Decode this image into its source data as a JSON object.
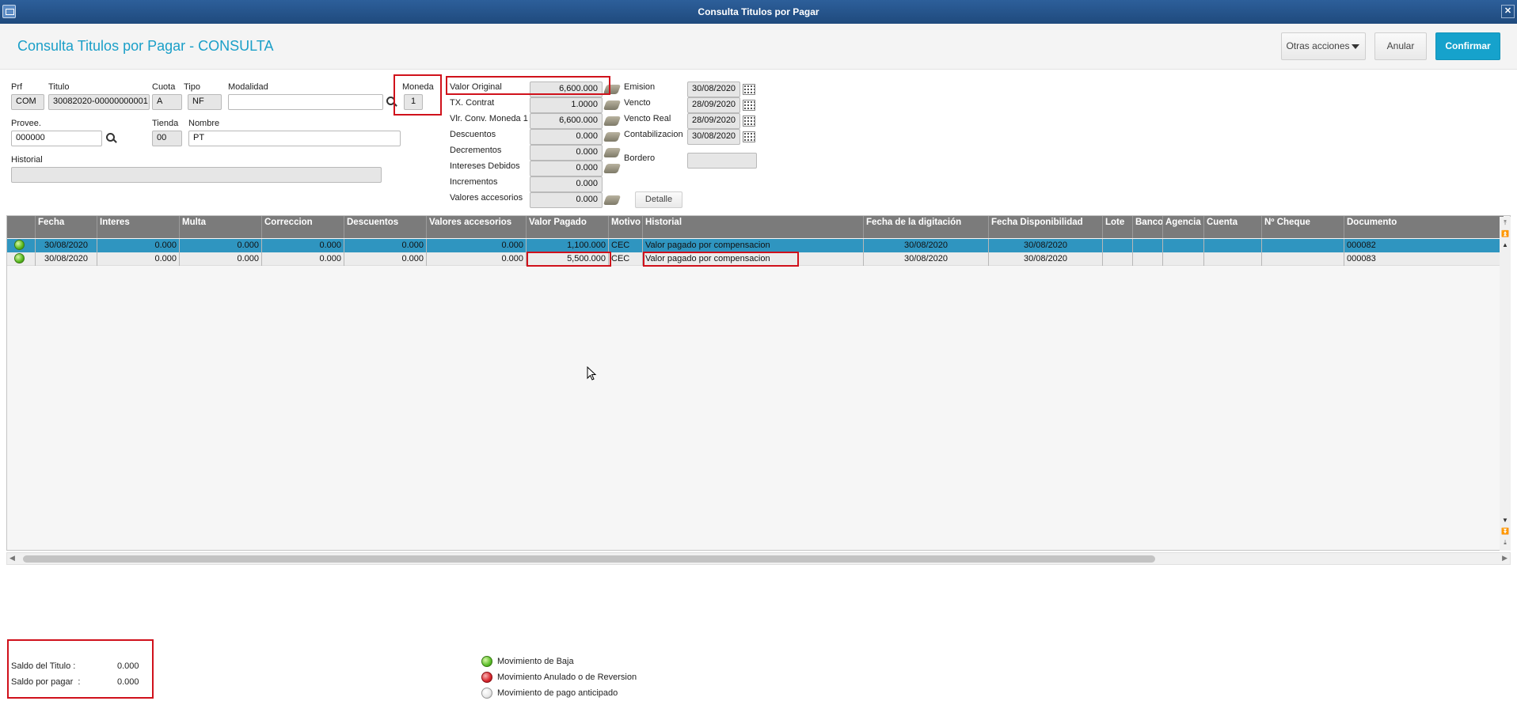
{
  "window": {
    "title": "Consulta Titulos por Pagar"
  },
  "header": {
    "title": "Consulta Titulos por Pagar - CONSULTA",
    "buttons": {
      "other_actions": "Otras acciones",
      "cancel": "Anular",
      "confirm": "Confirmar"
    }
  },
  "form": {
    "prf": {
      "label": "Prf",
      "value": "COM"
    },
    "titulo": {
      "label": "Titulo",
      "value": "30082020-00000000001"
    },
    "cuota": {
      "label": "Cuota",
      "value": "A"
    },
    "tipo": {
      "label": "Tipo",
      "value": "NF"
    },
    "modalidad": {
      "label": "Modalidad",
      "value": ""
    },
    "moneda": {
      "label": "Moneda",
      "value": "1"
    },
    "provee": {
      "label": "Provee.",
      "value": "000000"
    },
    "tienda": {
      "label": "Tienda",
      "value": "00"
    },
    "nombre": {
      "label": "Nombre",
      "value": "PT"
    },
    "historial": {
      "label": "Historial",
      "value": ""
    }
  },
  "values": [
    {
      "label": "Valor Original",
      "value": "6,600.000"
    },
    {
      "label": "TX. Contrat",
      "value": "1.0000"
    },
    {
      "label": "Vlr. Conv. Moneda 1",
      "value": "6,600.000"
    },
    {
      "label": "Descuentos",
      "value": "0.000"
    },
    {
      "label": "Decrementos",
      "value": "0.000"
    },
    {
      "label": "Intereses Debidos",
      "value": "0.000"
    },
    {
      "label": "Incrementos",
      "value": "0.000"
    },
    {
      "label": "Valores accesorios",
      "value": "0.000"
    }
  ],
  "dates": [
    {
      "label": "Emision",
      "value": "30/08/2020"
    },
    {
      "label": "Vencto",
      "value": "28/09/2020"
    },
    {
      "label": "Vencto Real",
      "value": "28/09/2020"
    },
    {
      "label": "Contabilizacion",
      "value": "30/08/2020"
    }
  ],
  "bordero": {
    "label": "Bordero",
    "value": ""
  },
  "detail_button": "Detalle",
  "grid": {
    "columns": [
      "Fecha",
      "Interes",
      "Multa",
      "Correccion",
      "Descuentos",
      "Valores accesorios",
      "Valor Pagado",
      "Motivo",
      "Historial",
      "Fecha de la digitación",
      "Fecha Disponibilidad",
      "Lote",
      "Banco",
      "Agencia",
      "Cuenta",
      "Nº Cheque",
      "Documento"
    ],
    "rows": [
      [
        "30/08/2020",
        "0.000",
        "0.000",
        "0.000",
        "0.000",
        "0.000",
        "1,100.000",
        "CEC",
        "Valor pagado por compensacion",
        "30/08/2020",
        "30/08/2020",
        "",
        "",
        "",
        "",
        "",
        "000082"
      ],
      [
        "30/08/2020",
        "0.000",
        "0.000",
        "0.000",
        "0.000",
        "0.000",
        "5,500.000",
        "CEC",
        "Valor pagado por compensacion",
        "30/08/2020",
        "30/08/2020",
        "",
        "",
        "",
        "",
        "",
        "000083"
      ]
    ]
  },
  "summary": {
    "saldo_titulo": {
      "label": "Saldo del Titulo :",
      "value": "0.000"
    },
    "saldo_pagar": {
      "label": "Saldo por pagar  :",
      "value": "0.000"
    }
  },
  "legend": [
    {
      "label": "Movimiento de Baja",
      "color": "#5cbf2a"
    },
    {
      "label": "Movimiento Anulado o de Reversion",
      "color": "#d8262d"
    },
    {
      "label": "Movimiento de pago anticipado",
      "color": "#e8e8e8"
    }
  ],
  "colors": {
    "accent": "#1a9fc8",
    "selected_row": "#2f95c0",
    "highlight": "#d0111b"
  }
}
